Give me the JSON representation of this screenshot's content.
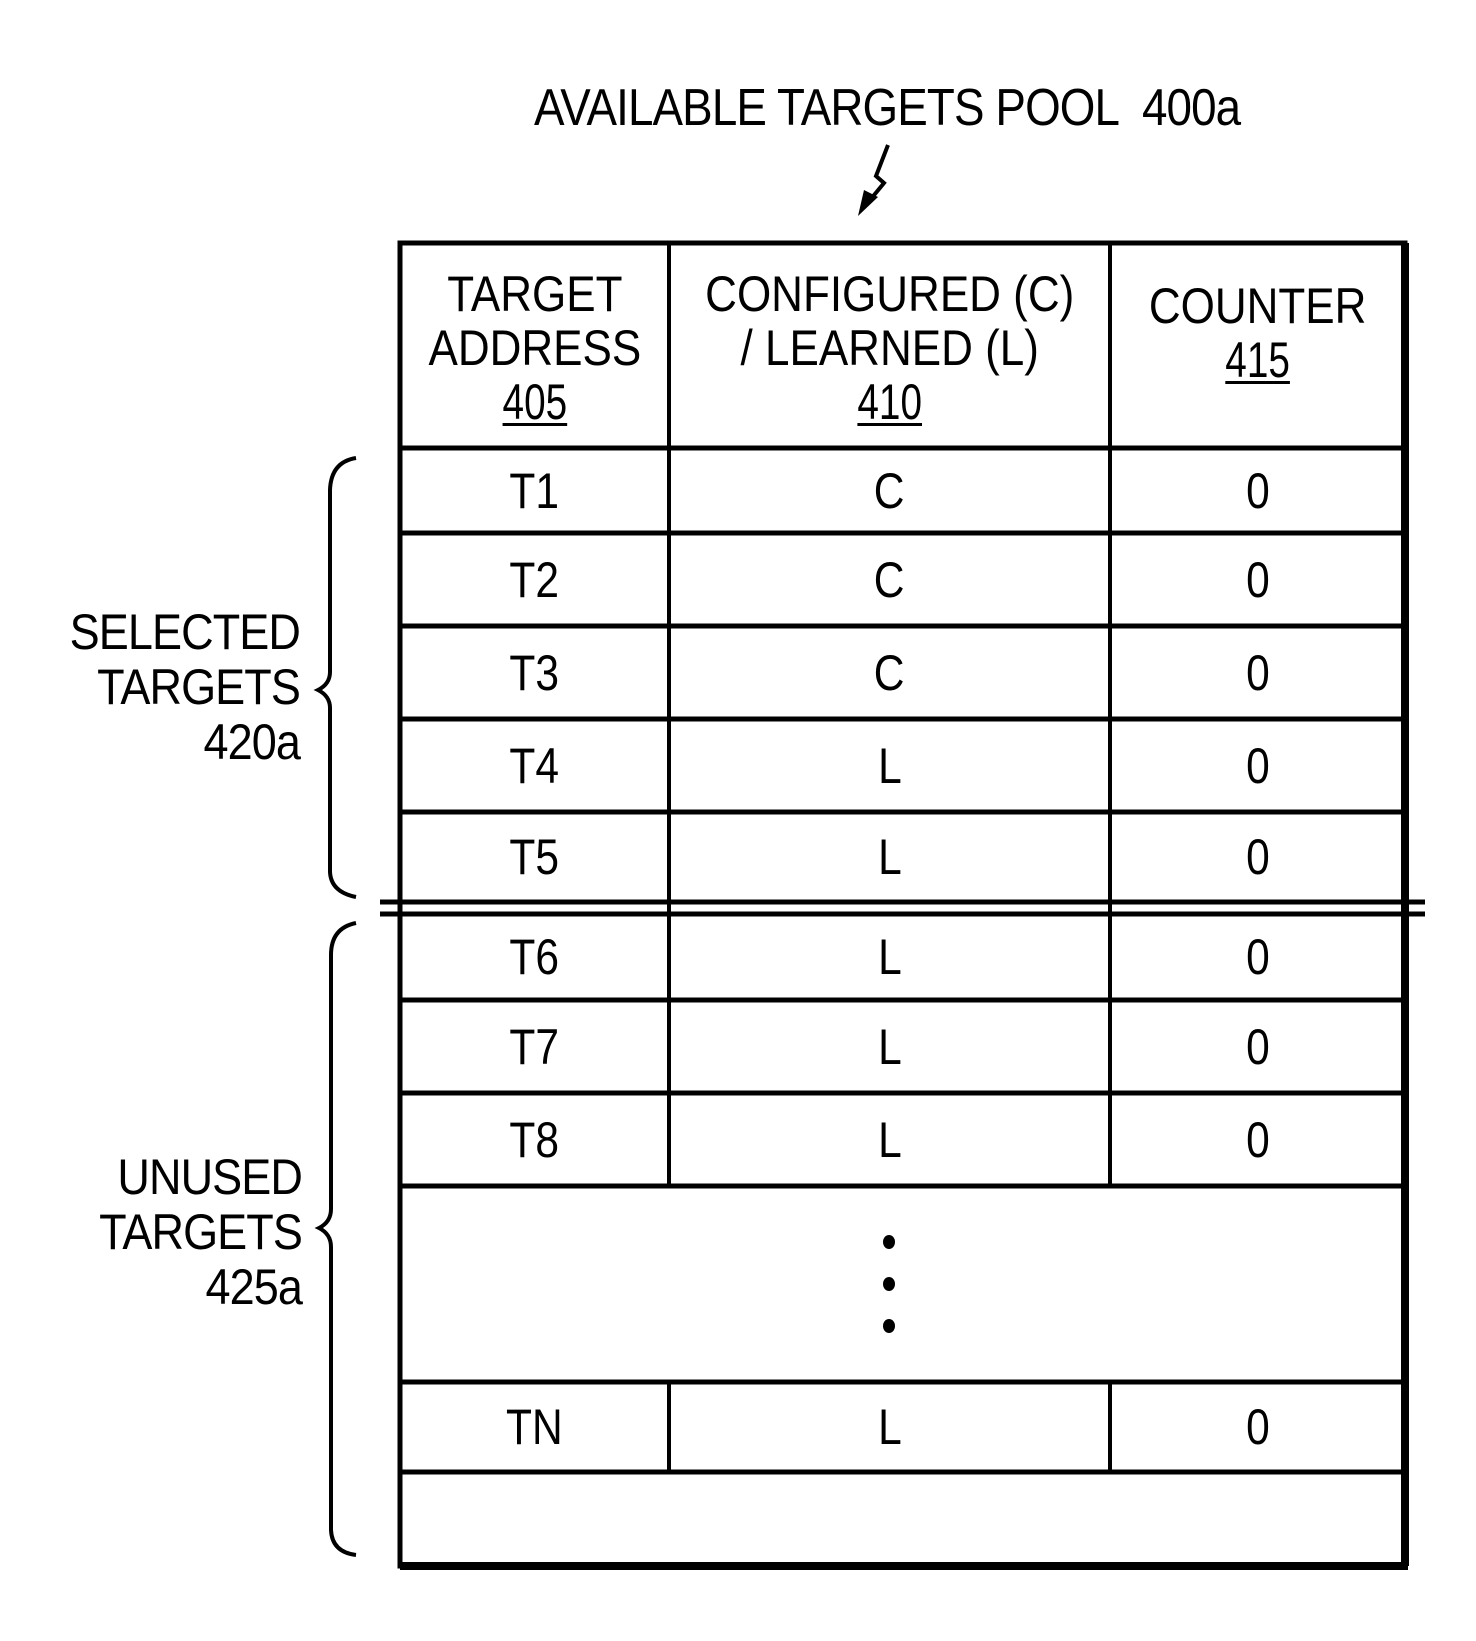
{
  "figure": {
    "title": "AVAILABLE TARGETS POOL",
    "title_ref": "400a"
  },
  "table": {
    "headers": [
      {
        "lines": [
          "TARGET",
          "ADDRESS"
        ],
        "ref": "405"
      },
      {
        "lines": [
          "CONFIGURED (C)",
          "/ LEARNED (L)"
        ],
        "ref": "410"
      },
      {
        "lines": [
          "COUNTER"
        ],
        "ref": "415"
      }
    ],
    "rows": [
      {
        "address": "T1",
        "type": "C",
        "counter": "0"
      },
      {
        "address": "T2",
        "type": "C",
        "counter": "0"
      },
      {
        "address": "T3",
        "type": "C",
        "counter": "0"
      },
      {
        "address": "T4",
        "type": "L",
        "counter": "0"
      },
      {
        "address": "T5",
        "type": "L",
        "counter": "0"
      },
      {
        "address": "T6",
        "type": "L",
        "counter": "0"
      },
      {
        "address": "T7",
        "type": "L",
        "counter": "0"
      },
      {
        "address": "T8",
        "type": "L",
        "counter": "0"
      },
      {
        "address": "TN",
        "type": "L",
        "counter": "0"
      }
    ],
    "ellipsis": "⋮"
  },
  "groups": [
    {
      "lines": [
        "SELECTED",
        "TARGETS"
      ],
      "ref": "420a"
    },
    {
      "lines": [
        "UNUSED",
        "TARGETS"
      ],
      "ref": "425a"
    }
  ]
}
